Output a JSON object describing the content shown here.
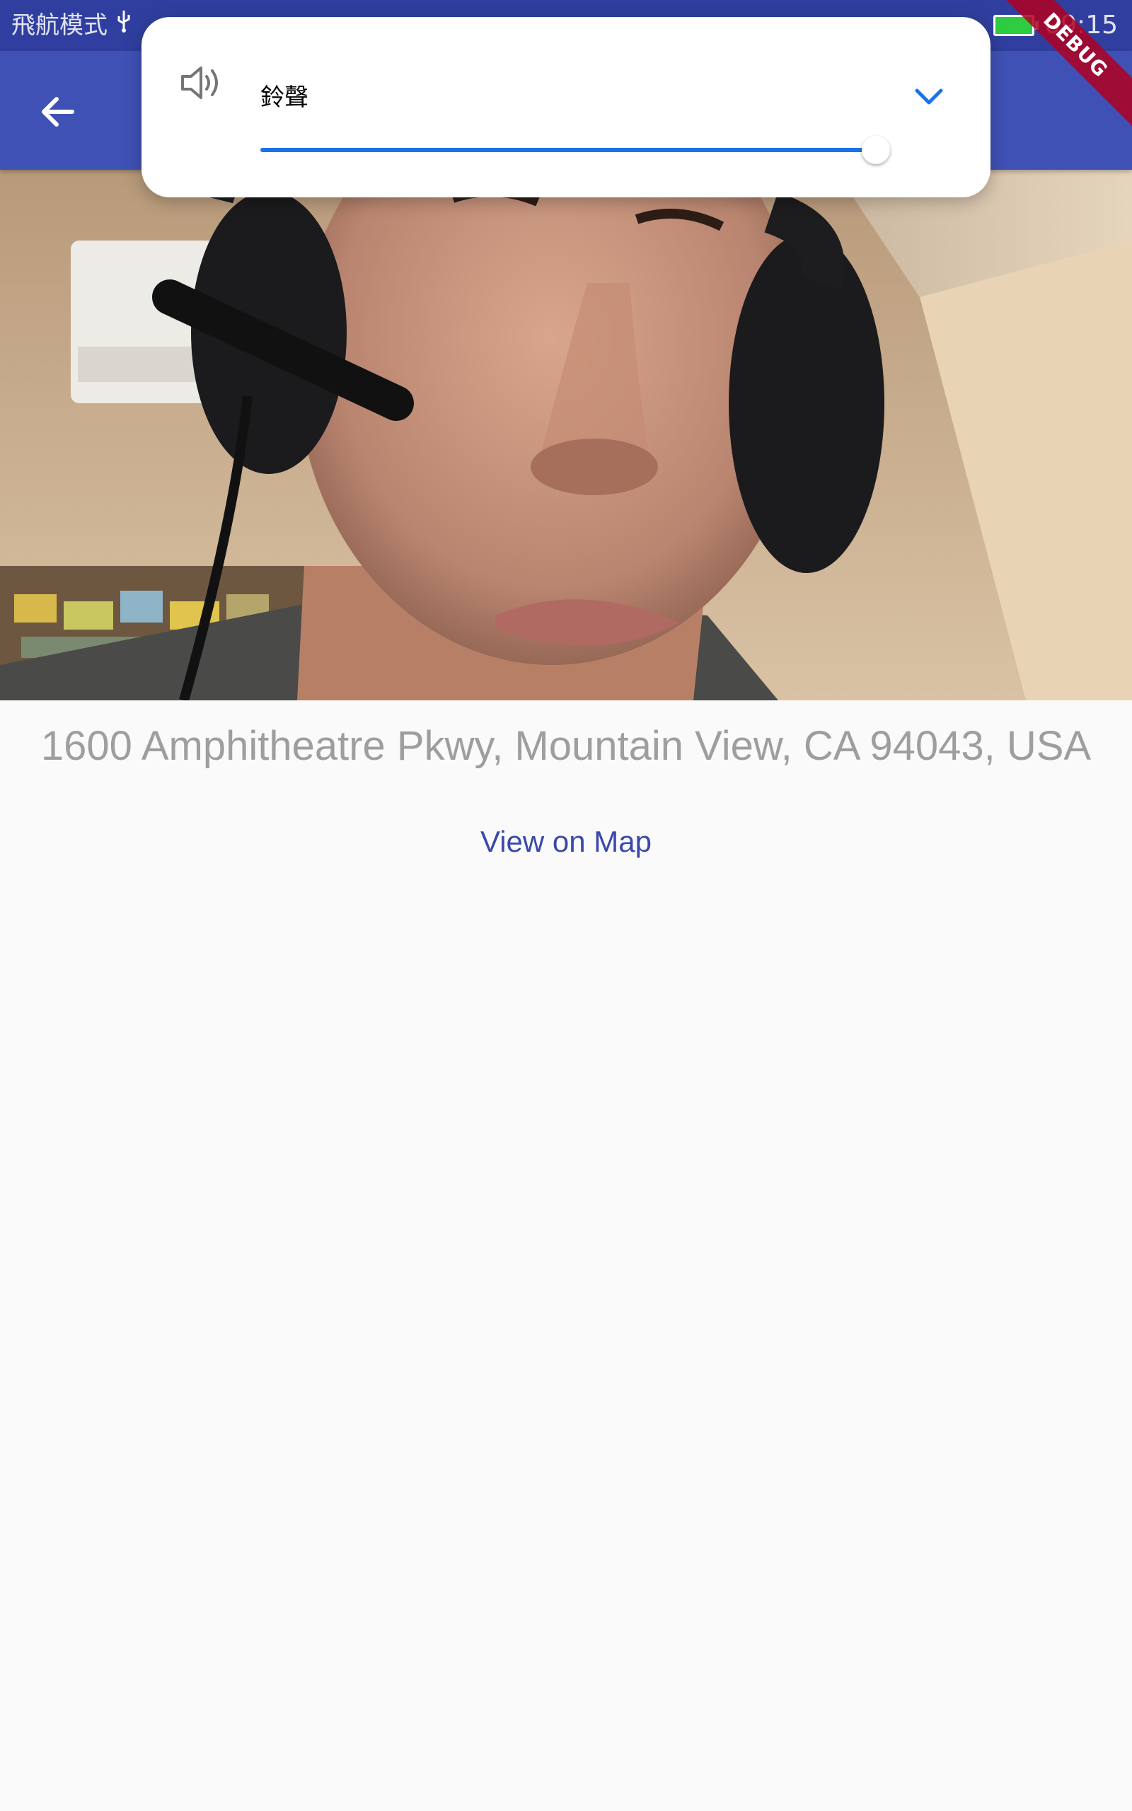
{
  "status_bar": {
    "airplane_mode_label": "飛航模式",
    "time": "09:15",
    "icons": [
      "usb-icon",
      "bluetooth-icon",
      "alarm-icon",
      "battery-charging-icon"
    ]
  },
  "app_bar": {
    "back_icon": "arrow-back-icon"
  },
  "debug_banner": {
    "label": "DEBUG"
  },
  "volume_panel": {
    "label": "鈴聲",
    "icon": "speaker-volume-icon",
    "expand_icon": "chevron-down-icon",
    "level_fraction": 1.0,
    "accent_color": "#1a73e8"
  },
  "location": {
    "address": "1600 Amphitheatre Pkwy, Mountain View, CA 94043, USA",
    "map_button_label": "View on Map"
  },
  "colors": {
    "app_bar": "#3f51b5",
    "status_bar": "#303f9f",
    "link": "#3949ab"
  }
}
